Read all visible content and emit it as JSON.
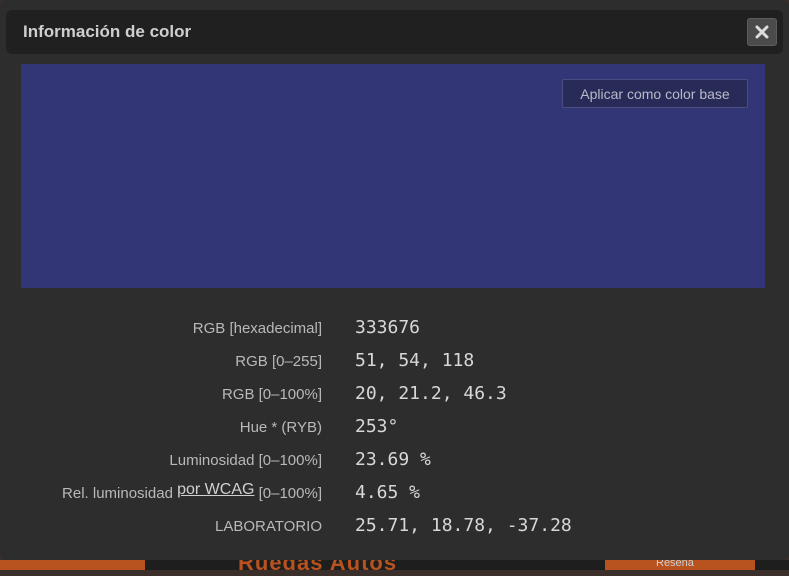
{
  "dialog": {
    "title": "Información de color",
    "close_icon": "close-icon",
    "apply_button_label": "Aplicar como color base",
    "swatch_color": "#333676"
  },
  "info": [
    {
      "label": "RGB [hexadecimal]",
      "value": "333676"
    },
    {
      "label": "RGB [0–255]",
      "value": "51, 54, 118"
    },
    {
      "label": "RGB [0–100%]",
      "value": "20, 21.2, 46.3"
    },
    {
      "label": "Hue * (RYB)",
      "value": "253°"
    },
    {
      "label": "Luminosidad [0–100%]",
      "value": "23.69 %"
    },
    {
      "label_prefix": "Rel. luminosidad",
      "label_link": "por WCAG",
      "label_suffix": "[0–100%]",
      "value": "4.65 %"
    },
    {
      "label": "LABORATORIO",
      "value": "25.71, 18.78, -37.28"
    }
  ],
  "background": {
    "title_fragment": "Ruedas Autos",
    "side_text": "Reseña"
  }
}
